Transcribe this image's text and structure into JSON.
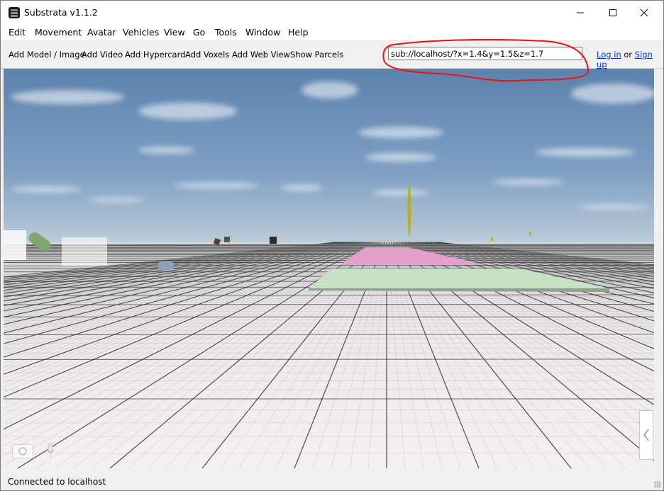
{
  "window": {
    "title": "Substrata v1.1.2",
    "controls": [
      "minimize",
      "maximize",
      "close"
    ]
  },
  "menu": [
    {
      "label": "Edit"
    },
    {
      "label": "Movement"
    },
    {
      "label": "Avatar"
    },
    {
      "label": "Vehicles"
    },
    {
      "label": "View"
    },
    {
      "label": "Go"
    },
    {
      "label": "Tools"
    },
    {
      "label": "Window"
    },
    {
      "label": "Help"
    }
  ],
  "toolbar": {
    "buttons": [
      {
        "label": "Add Model / Image"
      },
      {
        "label": "Add Video"
      },
      {
        "label": "Add Hypercard"
      },
      {
        "label": "Add Voxels"
      },
      {
        "label": "Add Web View"
      },
      {
        "label": "Show Parcels"
      }
    ],
    "url": "sub://localhost/?x=1.4&y=1.5&z=1.7",
    "login_label": "Log in",
    "or_label": "or",
    "signup_label": "Sign up"
  },
  "viewport": {
    "description": "3D world view with sky and grid ground plane",
    "colors": {
      "sky_top": "#5b82ad",
      "sky_horizon": "#b9c9d8",
      "ground": "#f2eeee",
      "parcel_pink": "#e3a0cc",
      "parcel_green": "#c6e1c4",
      "annotation": "#ee1111"
    },
    "icons": [
      "camera-icon",
      "microphone-icon",
      "chevron-left-icon"
    ]
  },
  "status": {
    "text": "Connected to localhost"
  }
}
